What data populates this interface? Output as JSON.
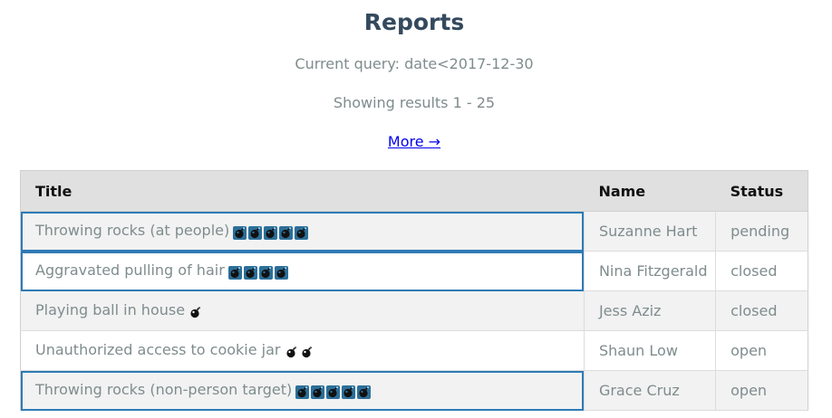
{
  "header": {
    "title": "Reports",
    "query": "Current query: date<2017-12-30",
    "results": "Showing results 1 - 25",
    "more_link": "More →"
  },
  "table": {
    "columns": [
      "Title",
      "Name",
      "Status"
    ],
    "rows": [
      {
        "title": "Throwing rocks (at people)",
        "severity": 5,
        "icon": "bomb-icon",
        "highlighted": true,
        "name": "Suzanne Hart",
        "status": "pending"
      },
      {
        "title": "Aggravated pulling of hair",
        "severity": 4,
        "icon": "bomb-icon",
        "highlighted": true,
        "name": "Nina Fitzgerald",
        "status": "closed"
      },
      {
        "title": "Playing ball in house",
        "severity": 1,
        "icon": "bomb-icon",
        "highlighted": false,
        "name": "Jess Aziz",
        "status": "closed"
      },
      {
        "title": "Unauthorized access to cookie jar",
        "severity": 2,
        "icon": "bomb-icon",
        "highlighted": false,
        "name": "Shaun Low",
        "status": "open"
      },
      {
        "title": "Throwing rocks (non-person target)",
        "severity": 5,
        "icon": "bomb-icon",
        "highlighted": true,
        "name": "Grace Cruz",
        "status": "open"
      }
    ]
  },
  "colors": {
    "title": "#34495e",
    "muted_text": "#7f8c8d",
    "link": "#0000ee",
    "highlight_border": "#2e7bb5",
    "icon_box": "#2c6f99"
  }
}
